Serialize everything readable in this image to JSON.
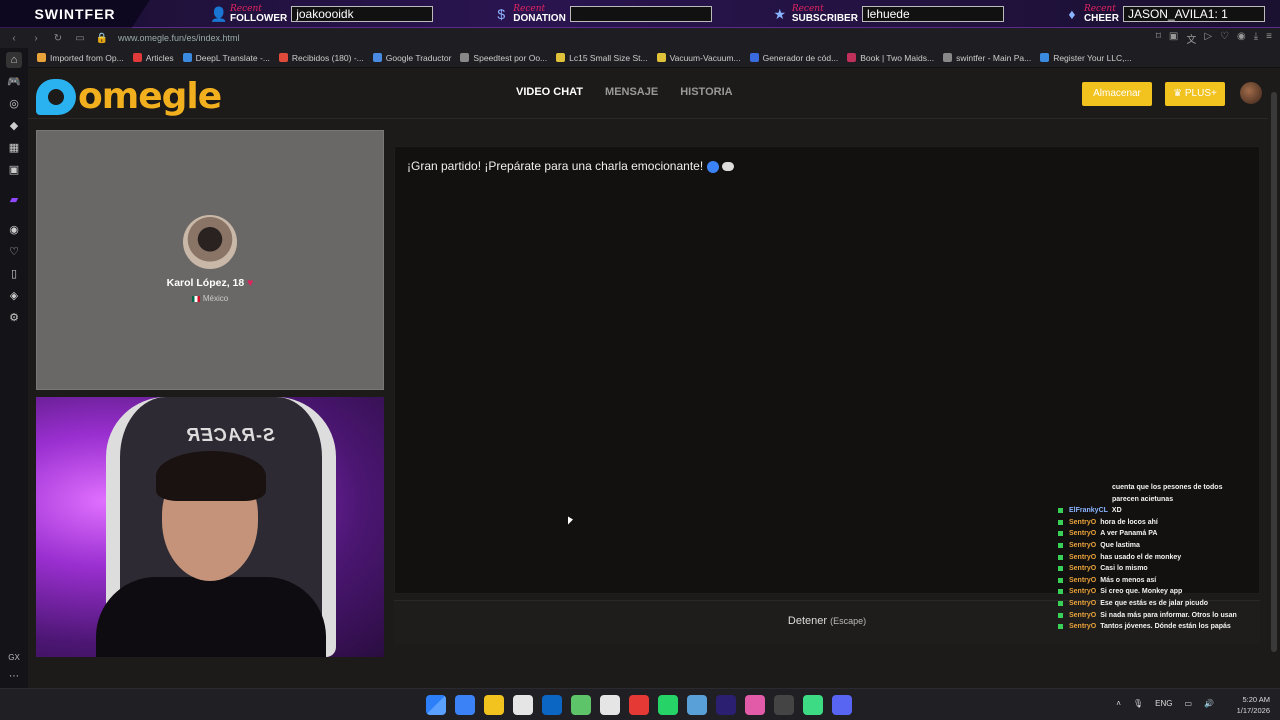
{
  "overlay": {
    "brand": "SWINTFER",
    "items": [
      {
        "recent": "Recent",
        "kind": "FOLLOWER",
        "value": "joakoooidk",
        "icon": "person-icon"
      },
      {
        "recent": "Recent",
        "kind": "DONATION",
        "value": "",
        "icon": "dollar-icon"
      },
      {
        "recent": "Recent",
        "kind": "SUBSCRIBER",
        "value": "lehuede",
        "icon": "star-icon"
      },
      {
        "recent": "Recent",
        "kind": "CHEER",
        "value": "JASON_AVILA1: 1",
        "icon": "drop-icon"
      }
    ]
  },
  "browser": {
    "url": "www.omegle.fun/es/index.html",
    "bookmarks": [
      "Imported from Op...",
      "Articles",
      "DeepL Translate -...",
      "Recibidos (180) -...",
      "Google Traductor",
      "Speedtest por Oo...",
      "Lc15 Small Size St...",
      "Vacuum-Vacuum...",
      "Generador de cód...",
      "Book | Two Maids...",
      "swintfer - Main Pa...",
      "Register Your LLC,..."
    ],
    "bookmark_colors": [
      "#e8a33a",
      "#e03a3a",
      "#3a8ae0",
      "#e04a3a",
      "#4a8ae0",
      "#888888",
      "#e0c23a",
      "#e0c23a",
      "#3a6ae0",
      "#c0305a",
      "#888888",
      "#3a8ae0"
    ]
  },
  "site": {
    "logo": "omegle",
    "nav": [
      {
        "label": "VIDEO CHAT",
        "active": true
      },
      {
        "label": "MENSAJE",
        "active": false
      },
      {
        "label": "HISTORIA",
        "active": false
      }
    ],
    "store_label": "Almacenar",
    "plus_label": "PLUS+",
    "profile": {
      "name": "Karol López, 18",
      "country": "México"
    },
    "chat_message": "¡Gran partido! ¡Prepárate para una charla emocionante!",
    "stop_label": "Detener",
    "stop_key": "(Escape)",
    "cam_chair_text": "S-RACER"
  },
  "twitch_chat": [
    {
      "user": "",
      "msg": "cuenta que los pesones de todos parecen acietunas",
      "dot": false
    },
    {
      "user": "ElFrankyCL",
      "msg": "XD",
      "dot": true,
      "blue": true
    },
    {
      "user": "SentryO",
      "msg": "hora de locos ahí",
      "dot": true
    },
    {
      "user": "SentryO",
      "msg": "A ver Panamá PA",
      "dot": true
    },
    {
      "user": "SentryO",
      "msg": "Que lastima",
      "dot": true
    },
    {
      "user": "SentryO",
      "msg": "has usado el de monkey",
      "dot": true
    },
    {
      "user": "SentryO",
      "msg": "Casi lo mismo",
      "dot": true
    },
    {
      "user": "SentryO",
      "msg": "Más o menos así",
      "dot": true
    },
    {
      "user": "SentryO",
      "msg": "Si creo que. Monkey app",
      "dot": true
    },
    {
      "user": "SentryO",
      "msg": "Ese que estás es de jalar picudo",
      "dot": true
    },
    {
      "user": "SentryO",
      "msg": "Si nada más para informar. Otros lo usan",
      "dot": true
    },
    {
      "user": "SentryO",
      "msg": "Tantos jóvenes. Dónde están los papás",
      "dot": true
    }
  ],
  "taskbar": {
    "tray_lang": "ENG",
    "time": "5:20 AM",
    "date": "1/17/2026",
    "app_colors": [
      "#2d7ff9",
      "#3b82f6",
      "#f2c21e",
      "#e5e5e5",
      "#0a66c2",
      "#5ec46a",
      "#e5e5e5",
      "#e53935",
      "#25d366",
      "#5aa0d8",
      "#2a1f70",
      "#e15ba8",
      "#444444",
      "#3ddc84",
      "#5865f2"
    ]
  },
  "sidebar_icons": [
    "home-icon",
    "game-icon",
    "swirl-icon",
    "aria-icon",
    "chart-icon",
    "box-icon",
    "twitch-icon",
    "play-icon",
    "heart-icon",
    "book-icon",
    "diamond-icon",
    "settings-icon"
  ],
  "sidebar_glyphs": [
    "⌂",
    "🎮",
    "◎",
    "◆",
    "▦",
    "▣",
    "▰",
    "◉",
    "♡",
    "▯",
    "◈",
    "⚙"
  ],
  "sidebar_gx": "GX"
}
